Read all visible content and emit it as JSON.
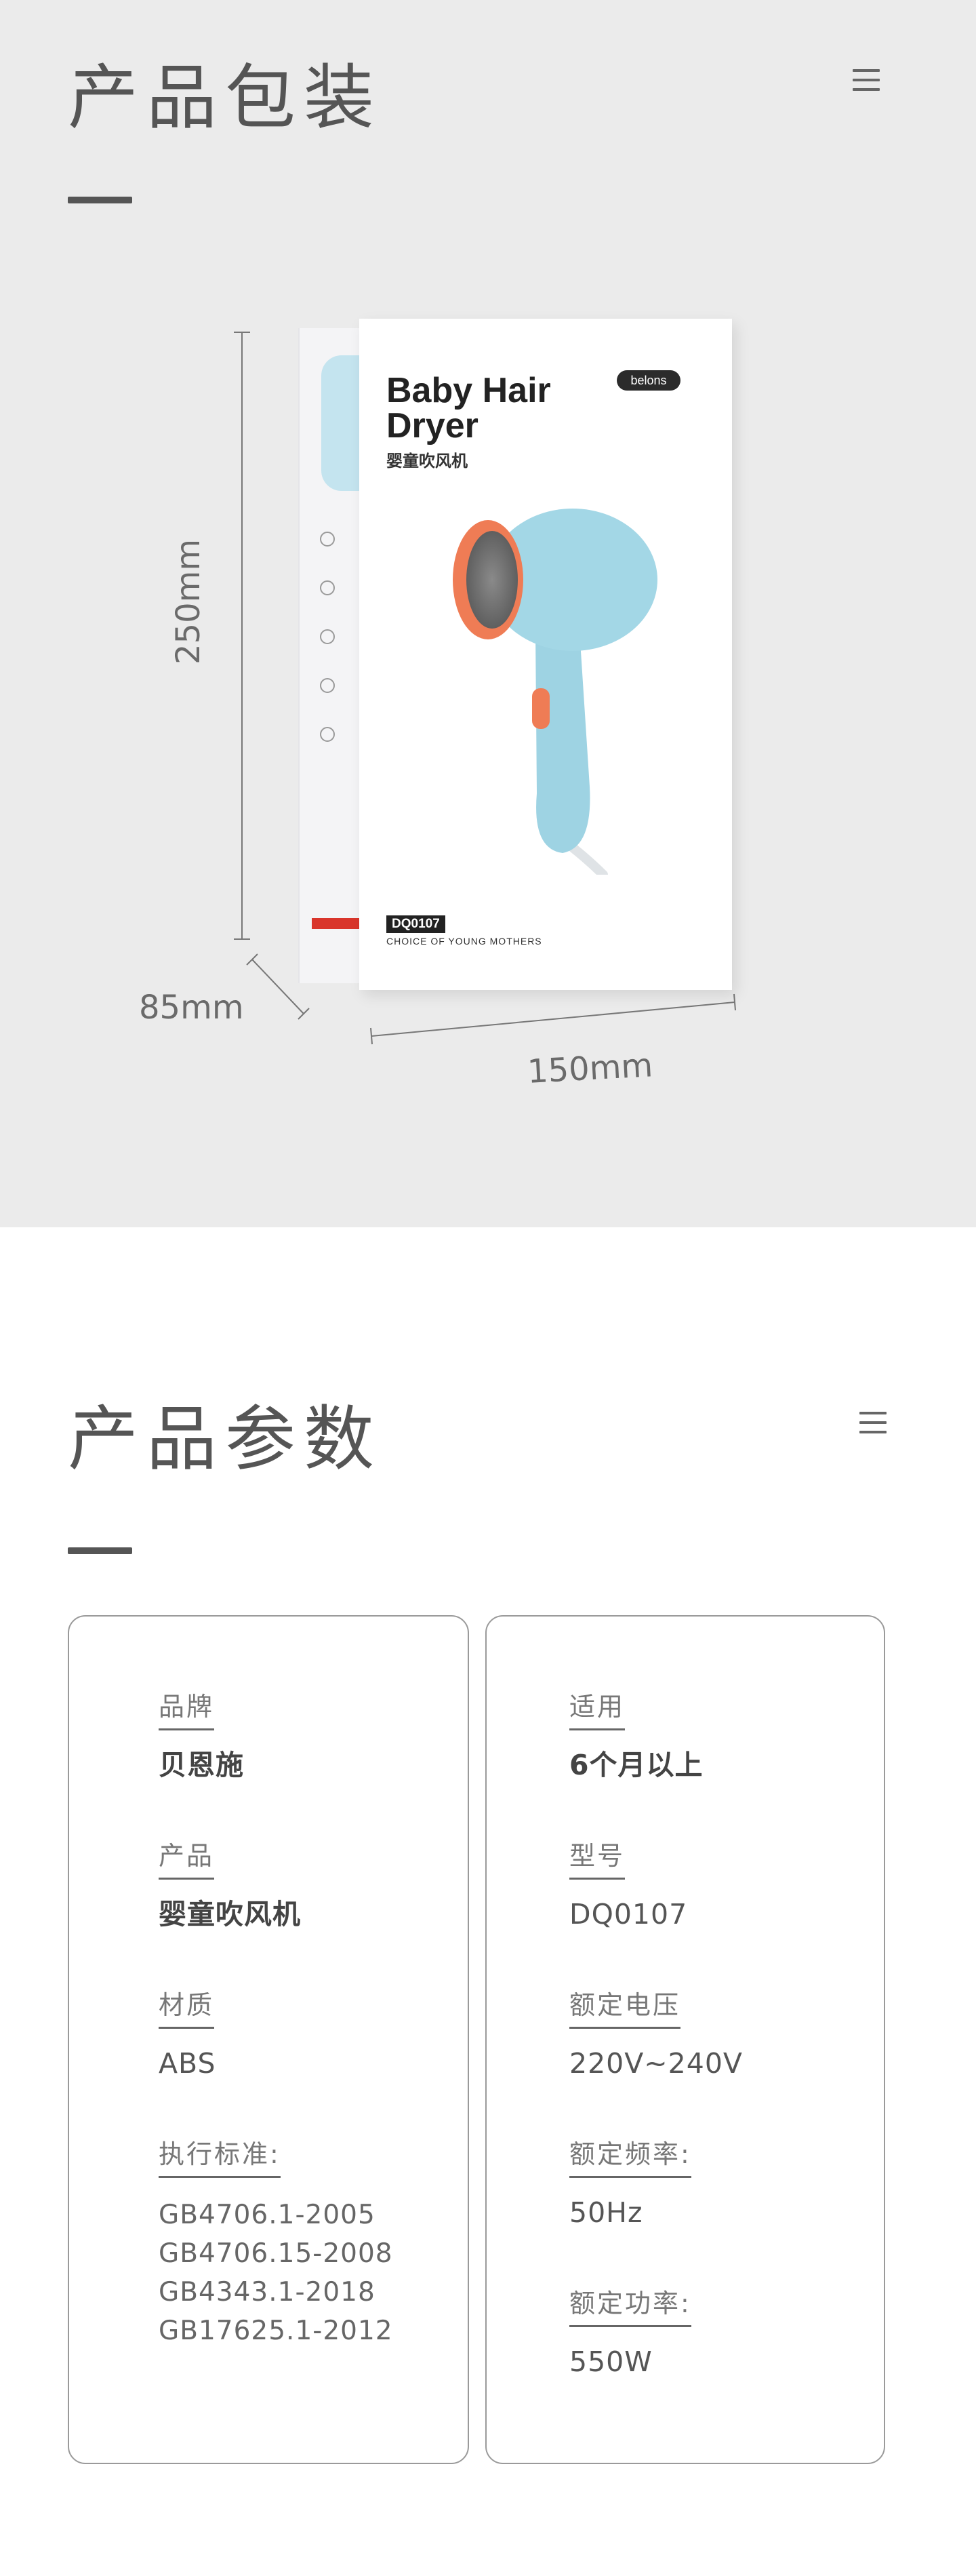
{
  "packaging": {
    "title": "产品包装",
    "box": {
      "title_line1": "Baby Hair",
      "title_line2": "Dryer",
      "subtitle": "婴童吹风机",
      "brand": "belons",
      "model": "DQ0107",
      "slogan": "CHOICE OF YOUNG MOTHERS"
    },
    "dimensions": {
      "height": "250mm",
      "depth": "85mm",
      "width": "150mm"
    },
    "colors": {
      "background": "#ebebeb",
      "dryer_body": "#9ed3e3",
      "dryer_accent": "#ef7c55"
    }
  },
  "params": {
    "title": "产品参数",
    "left": [
      {
        "label": "品牌",
        "value": "贝恩施"
      },
      {
        "label": "产品",
        "value": "婴童吹风机"
      },
      {
        "label": "材质",
        "value": "ABS"
      },
      {
        "label": "执行标准:",
        "values": [
          "GB4706.1-2005",
          "GB4706.15-2008",
          "GB4343.1-2018",
          "GB17625.1-2012"
        ]
      }
    ],
    "right": [
      {
        "label": "适用",
        "value": "6个月以上"
      },
      {
        "label": "型号",
        "value": "DQ0107"
      },
      {
        "label": "额定电压",
        "value": "220V~240V"
      },
      {
        "label": "额定频率:",
        "value": "50Hz"
      },
      {
        "label": "额定功率:",
        "value": "550W"
      }
    ]
  },
  "icons": [
    "menu-icon"
  ]
}
